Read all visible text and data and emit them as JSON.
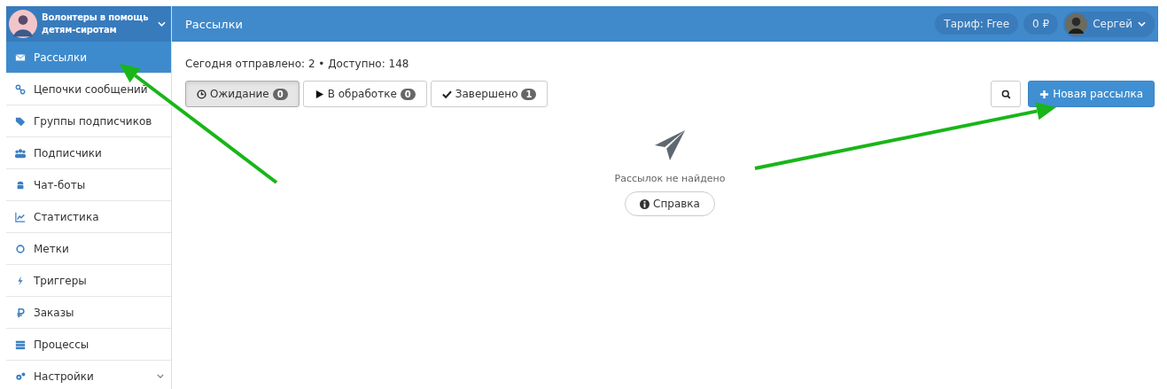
{
  "account": {
    "name": "Волонтеры в помощь детям-сиротам"
  },
  "sidebar": {
    "items": [
      {
        "label": "Рассылки",
        "selected": true,
        "submenu": false
      },
      {
        "label": "Цепочки сообщений",
        "selected": false,
        "submenu": false
      },
      {
        "label": "Группы подписчиков",
        "selected": false,
        "submenu": false
      },
      {
        "label": "Подписчики",
        "selected": false,
        "submenu": false
      },
      {
        "label": "Чат-боты",
        "selected": false,
        "submenu": false
      },
      {
        "label": "Статистика",
        "selected": false,
        "submenu": false
      },
      {
        "label": "Метки",
        "selected": false,
        "submenu": false
      },
      {
        "label": "Триггеры",
        "selected": false,
        "submenu": false
      },
      {
        "label": "Заказы",
        "selected": false,
        "submenu": false
      },
      {
        "label": "Процессы",
        "selected": false,
        "submenu": false
      },
      {
        "label": "Настройки",
        "selected": false,
        "submenu": true
      }
    ]
  },
  "header": {
    "title": "Рассылки",
    "tariff": "Тариф: Free",
    "balance": "0 ₽",
    "user": "Сергей"
  },
  "summary": "Сегодня отправлено: 2 • Доступно: 148",
  "filters": [
    {
      "label": "Ожидание",
      "count": "0",
      "selected": true
    },
    {
      "label": "В обработке",
      "count": "0",
      "selected": false
    },
    {
      "label": "Завершено",
      "count": "1",
      "selected": false
    }
  ],
  "new_button": "Новая рассылка",
  "empty": {
    "message": "Рассылок не найдено",
    "help_button": "Справка"
  },
  "annotations": [
    {
      "kind": "arrow"
    },
    {
      "kind": "arrow"
    }
  ]
}
